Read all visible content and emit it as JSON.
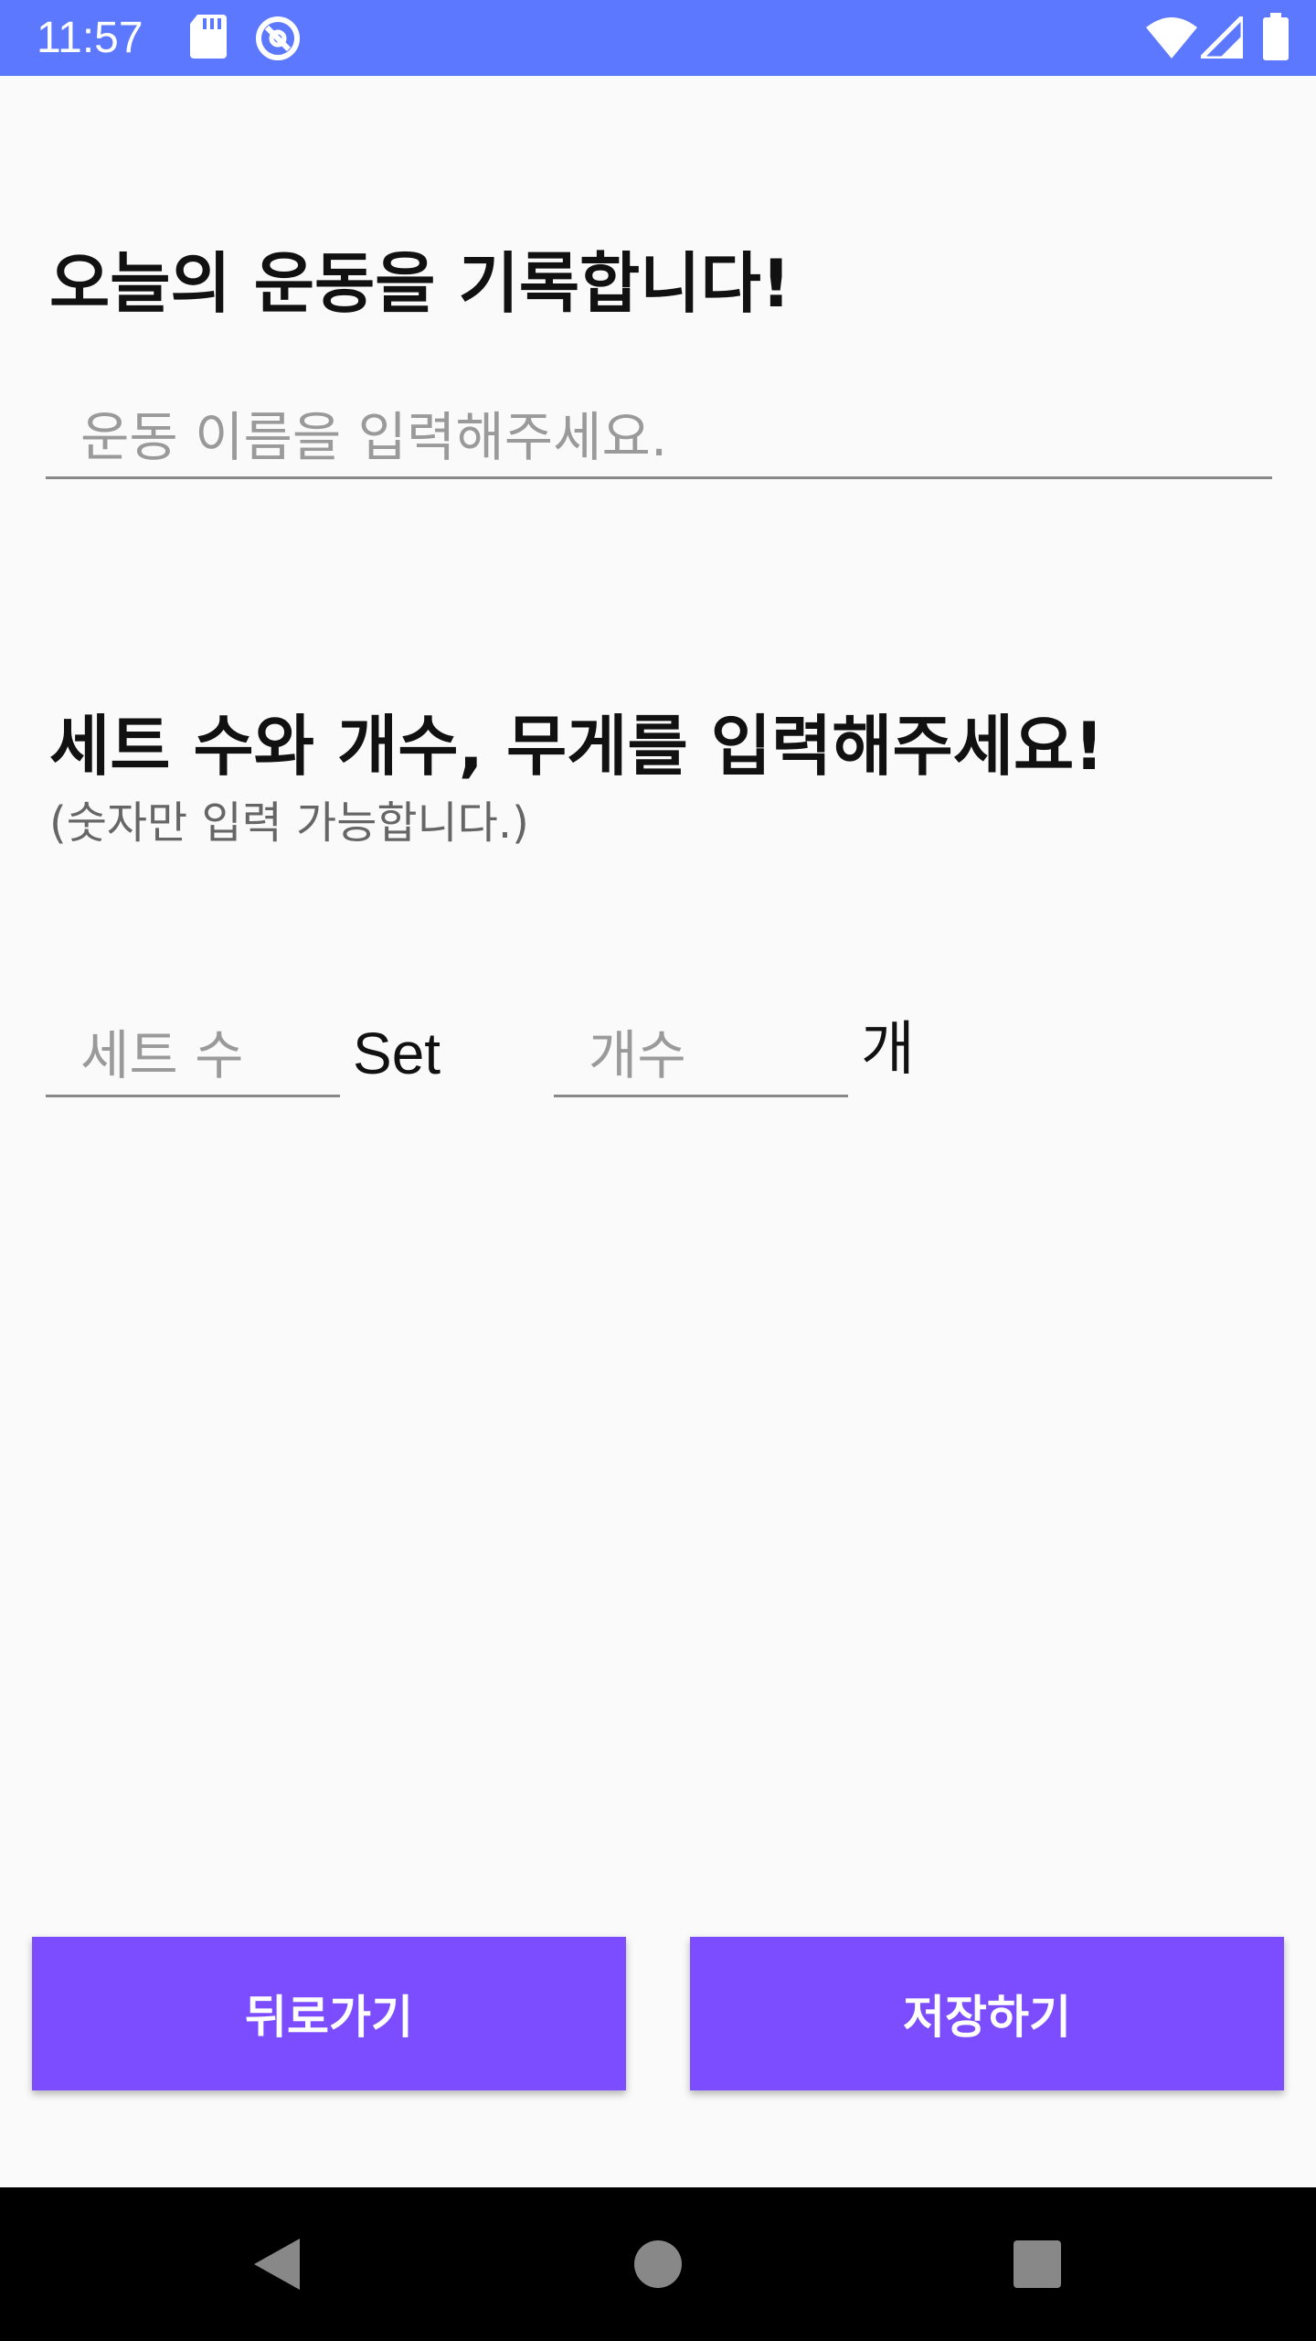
{
  "status_bar": {
    "time": "11:57",
    "icons": [
      "sd-card-icon",
      "do-not-disturb-icon",
      "wifi-icon",
      "cell-signal-icon",
      "battery-icon"
    ],
    "background_color": "#5B78FF"
  },
  "form": {
    "title": "오늘의 운동을 기록합니다!",
    "exercise_name_placeholder": "운동 이름을 입력해주세요.",
    "exercise_name_value": "",
    "sets_title": "세트 수와 개수, 무게를 입력해주세요!",
    "sets_hint": "(숫자만 입력 가능합니다.)",
    "sets_placeholder": "세트 수",
    "sets_value": "",
    "sets_unit": "Set",
    "reps_placeholder": "개수",
    "reps_value": "",
    "reps_unit": "개"
  },
  "buttons": {
    "back_label": "뒤로가기",
    "save_label": "저장하기",
    "color": "#7C4DFF"
  },
  "nav_bar": {
    "icons": [
      "back-triangle-icon",
      "home-circle-icon",
      "recents-square-icon"
    ]
  }
}
